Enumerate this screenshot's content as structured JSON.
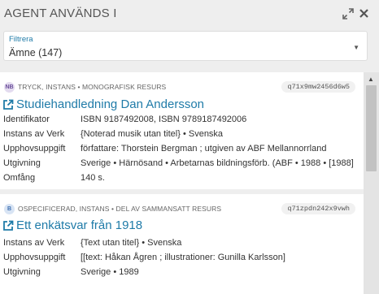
{
  "panel": {
    "title": "AGENT ANVÄNDS I",
    "icons": {
      "expand": "expand-icon",
      "close": "close-icon"
    }
  },
  "filter": {
    "label": "Filtrera",
    "value": "Ämne (147)"
  },
  "results": [
    {
      "badge": "NB",
      "meta": "TRYCK, INSTANS • MONOGRAFISK RESURS",
      "id": "q71x9mw2456d6w5",
      "title": "Studiehandledning Dan Andersson",
      "props": [
        {
          "label": "Identifikator",
          "value": "ISBN 9187492008, ISBN 9789187492006"
        },
        {
          "label": "Instans av Verk",
          "value": "{Noterad musik utan titel} • Svenska"
        },
        {
          "label": "Upphovsuppgift",
          "value": "författare: Thorstein Bergman ; utgiven av ABF Mellannorrland"
        },
        {
          "label": "Utgivning",
          "value": "Sverige • Härnösand • Arbetarnas bildningsförb. (ABF • 1988 • [1988]"
        },
        {
          "label": "Omfång",
          "value": "140 s."
        }
      ]
    },
    {
      "badge": "B",
      "meta": "OSPECIFICERAD, INSTANS • DEL AV SAMMANSATT RESURS",
      "id": "q71zpdn242x9vwh",
      "title": "Ett enkätsvar från 1918",
      "props": [
        {
          "label": "Instans av Verk",
          "value": "{Text utan titel} • Svenska"
        },
        {
          "label": "Upphovsuppgift",
          "value": "[[text: Håkan Ågren ; illustrationer: Gunilla Karlsson]"
        },
        {
          "label": "Utgivning",
          "value": "Sverige • 1989"
        }
      ]
    }
  ],
  "colors": {
    "accent": "#1f7ba8",
    "background": "#eeeeee",
    "card": "#ffffff"
  }
}
